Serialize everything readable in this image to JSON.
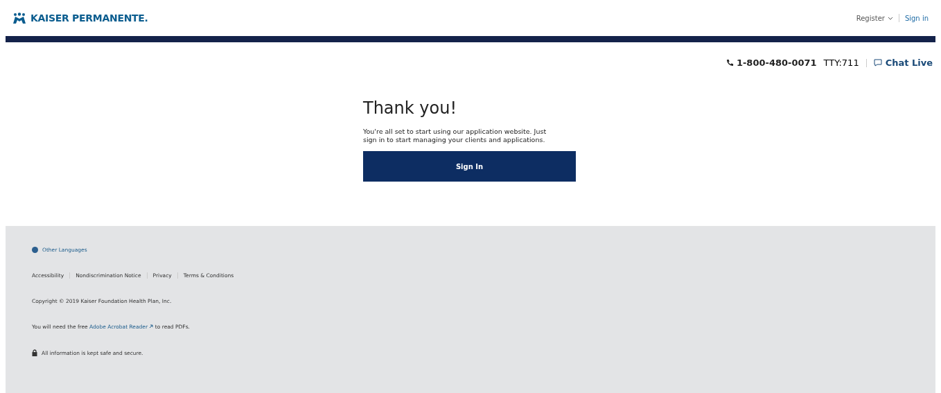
{
  "header": {
    "logo_text": "KAISER PERMANENTE.",
    "register": "Register",
    "sign_in": "Sign in"
  },
  "contact": {
    "phone": "1-800-480-0071",
    "tty": "TTY:711",
    "chat": "Chat Live"
  },
  "main": {
    "title": "Thank you!",
    "message": "You're all set to start using our application website. Just sign in to start managing your clients and applications.",
    "button": "Sign In"
  },
  "footer": {
    "languages": "Other Languages",
    "links": [
      "Accessibility",
      "Nondiscrimination Notice",
      "Privacy",
      "Terms & Conditions"
    ],
    "copyright": "Copyright © 2019 Kaiser Foundation Health Plan, Inc.",
    "pdf_note": {
      "before": "You will need the free",
      "link": "Adobe Acrobat Reader",
      "after": "to read PDFs."
    },
    "security": "All information is kept safe and secure."
  }
}
